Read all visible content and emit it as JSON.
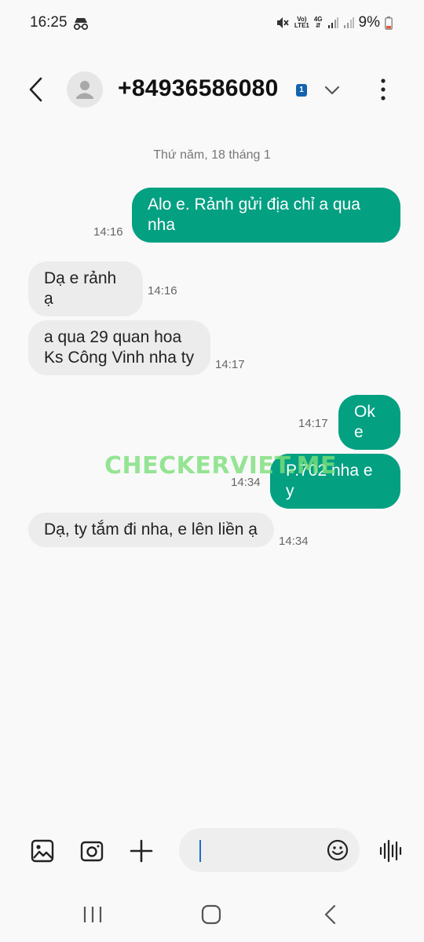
{
  "status_bar": {
    "time": "16:25",
    "network_top": "Vo)",
    "network_bottom": "LTE1",
    "data_top": "4G",
    "battery": "9%",
    "icons": [
      "incognito-icon",
      "mute-icon",
      "signal-icon",
      "battery-icon"
    ]
  },
  "header": {
    "contact": "+84936586080",
    "sim": "1"
  },
  "conversation": {
    "date": "Thứ năm, 18 tháng 1",
    "messages": [
      {
        "direction": "out",
        "text": "Alo e. Rảnh gửi địa chỉ a qua nha",
        "time": "14:16"
      },
      {
        "direction": "in",
        "text": "Dạ e rảnh ạ",
        "time": "14:16"
      },
      {
        "direction": "in",
        "text": "a qua 29 quan hoa Ks Công Vinh nha ty",
        "time": "14:17"
      },
      {
        "direction": "out",
        "text": "Ok e",
        "time": "14:17"
      },
      {
        "direction": "out",
        "text": "P.702 nha e y",
        "time": "14:34"
      },
      {
        "direction": "in",
        "text": "Dạ, ty tắm đi nha, e lên liền ạ",
        "time": "14:34"
      }
    ]
  },
  "watermark": "CHECKERVIET.ME",
  "composer": {
    "icons": [
      "gallery-icon",
      "camera-icon",
      "add-icon",
      "emoji-icon",
      "voice-icon"
    ]
  },
  "nav": {
    "icons": [
      "recent-apps-icon",
      "home-icon",
      "back-nav-icon"
    ]
  },
  "colors": {
    "outgoing_bubble": "#03a082",
    "incoming_bubble": "#ececec",
    "background": "#f9f9f9",
    "sim_badge": "#1463b0",
    "caret": "#1b70c8"
  }
}
